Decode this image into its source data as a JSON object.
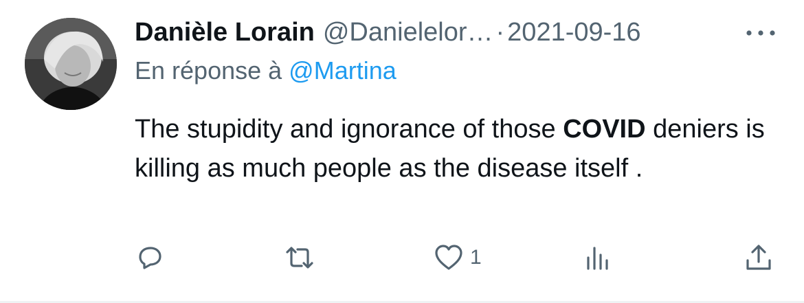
{
  "tweet": {
    "author_name": "Danièle Lorain",
    "author_handle": "@Danielelor…",
    "separator": "·",
    "date": "2021-09-16",
    "reply_prefix": "En réponse à",
    "reply_to": "@Martina",
    "text_before_bold": "The stupidity and ignorance of those ",
    "text_bold": "COVID",
    "text_after_bold": " deniers is killing as much people as the disease itself ."
  },
  "actions": {
    "reply_icon": "reply-icon",
    "retweet_icon": "retweet-icon",
    "like_icon": "heart-icon",
    "like_count": "1",
    "views_icon": "views-chart-icon",
    "share_icon": "share-icon"
  },
  "colors": {
    "text_primary": "#0f1419",
    "text_secondary": "#536471",
    "accent": "#1d9bf0"
  }
}
